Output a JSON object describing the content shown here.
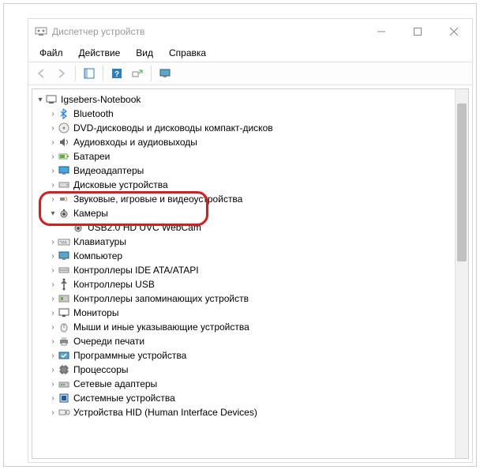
{
  "window": {
    "title": "Диспетчер устройств"
  },
  "menu": {
    "file": "Файл",
    "action": "Действие",
    "view": "Вид",
    "help": "Справка"
  },
  "tree": {
    "root": "Igsebers-Notebook",
    "items": [
      {
        "label": "Bluetooth",
        "icon": "bluetooth"
      },
      {
        "label": "DVD-дисководы и дисководы компакт-дисков",
        "icon": "cdrom"
      },
      {
        "label": "Аудиовходы и аудиовыходы",
        "icon": "audio"
      },
      {
        "label": "Батареи",
        "icon": "battery"
      },
      {
        "label": "Видеоадаптеры",
        "icon": "display"
      },
      {
        "label": "Дисковые устройства",
        "icon": "disk"
      },
      {
        "label": "Звуковые, игровые и видеоустройства",
        "icon": "sound"
      },
      {
        "label": "Камеры",
        "icon": "camera",
        "expanded": true,
        "children": [
          {
            "label": "USB2.0 HD UVC WebCam",
            "icon": "camera"
          }
        ]
      },
      {
        "label": "Клавиатуры",
        "icon": "keyboard"
      },
      {
        "label": "Компьютер",
        "icon": "computer"
      },
      {
        "label": "Контроллеры IDE ATA/ATAPI",
        "icon": "ide"
      },
      {
        "label": "Контроллеры USB",
        "icon": "usb"
      },
      {
        "label": "Контроллеры запоминающих устройств",
        "icon": "storage"
      },
      {
        "label": "Мониторы",
        "icon": "monitor"
      },
      {
        "label": "Мыши и иные указывающие устройства",
        "icon": "mouse"
      },
      {
        "label": "Очереди печати",
        "icon": "printer"
      },
      {
        "label": "Программные устройства",
        "icon": "software"
      },
      {
        "label": "Процессоры",
        "icon": "cpu"
      },
      {
        "label": "Сетевые адаптеры",
        "icon": "network"
      },
      {
        "label": "Системные устройства",
        "icon": "system"
      },
      {
        "label": "Устройства HID (Human Interface Devices)",
        "icon": "hid"
      }
    ]
  }
}
